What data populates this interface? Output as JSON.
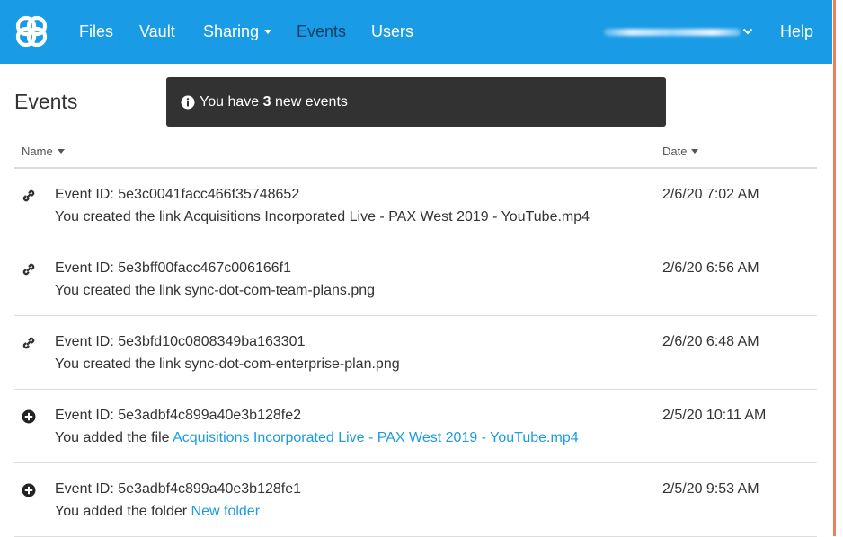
{
  "nav": {
    "items": [
      "Files",
      "Vault",
      "Sharing",
      "Events",
      "Users"
    ],
    "help": "Help",
    "active": "Events"
  },
  "page": {
    "title": "Events"
  },
  "toast": {
    "prefix": "You have",
    "count": "3",
    "suffix": "new events",
    "icon": "info-circle-icon"
  },
  "table": {
    "col_name": "Name",
    "col_date": "Date",
    "rows": [
      {
        "icon": "link-icon",
        "id": "Event ID: 5e3c0041facc466f35748652",
        "desc": "You created the link Acquisitions Incorporated Live - PAX West 2019 - YouTube.mp4",
        "link": "",
        "date": "2/6/20 7:02 AM"
      },
      {
        "icon": "link-icon",
        "id": "Event ID: 5e3bff00facc467c006166f1",
        "desc": "You created the link sync-dot-com-team-plans.png",
        "link": "",
        "date": "2/6/20 6:56 AM"
      },
      {
        "icon": "link-icon",
        "id": "Event ID: 5e3bfd10c0808349ba163301",
        "desc": "You created the link sync-dot-com-enterprise-plan.png",
        "link": "",
        "date": "2/6/20 6:48 AM"
      },
      {
        "icon": "plus-circle-icon",
        "id": "Event ID: 5e3adbf4c899a40e3b128fe2",
        "desc": "You added the file",
        "link": "Acquisitions Incorporated Live - PAX West 2019 - YouTube.mp4",
        "date": "2/5/20 10:11 AM"
      },
      {
        "icon": "plus-circle-icon",
        "id": "Event ID: 5e3adbf4c899a40e3b128fe1",
        "desc": "You added the folder",
        "link": "New folder",
        "date": "2/5/20 9:53 AM"
      }
    ]
  },
  "colors": {
    "navbar": "#1a9be6",
    "nav_active": "#123f66",
    "link": "#1a9be6",
    "toast_bg": "#323232"
  }
}
